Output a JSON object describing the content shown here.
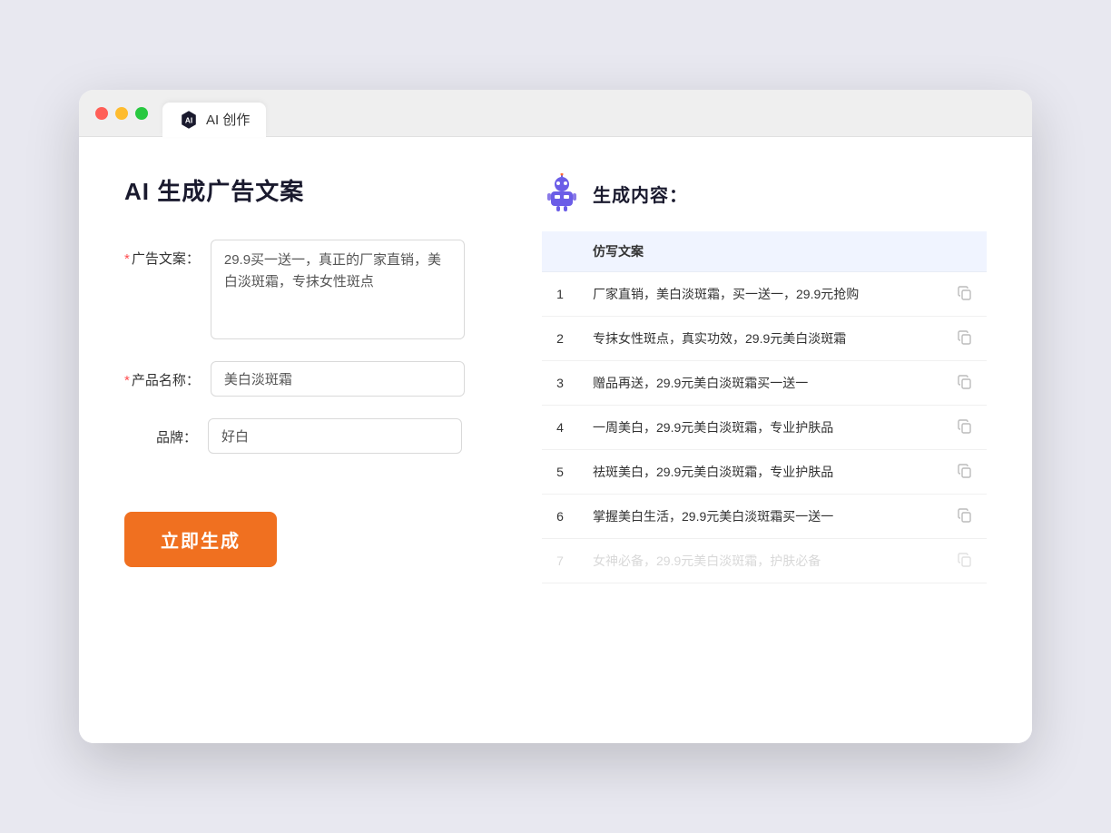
{
  "browser": {
    "tab_label": "AI 创作"
  },
  "page": {
    "title": "AI 生成广告文案"
  },
  "form": {
    "ad_label": "广告文案：",
    "ad_required": "*",
    "ad_value": "29.9买一送一，真正的厂家直销，美白淡斑霜，专抹女性斑点",
    "product_label": "产品名称：",
    "product_required": "*",
    "product_value": "美白淡斑霜",
    "brand_label": "品牌：",
    "brand_value": "好白",
    "generate_label": "立即生成"
  },
  "result": {
    "title": "生成内容：",
    "table_header": "仿写文案",
    "items": [
      {
        "num": "1",
        "text": "厂家直销，美白淡斑霜，买一送一，29.9元抢购",
        "faded": false
      },
      {
        "num": "2",
        "text": "专抹女性斑点，真实功效，29.9元美白淡斑霜",
        "faded": false
      },
      {
        "num": "3",
        "text": "赠品再送，29.9元美白淡斑霜买一送一",
        "faded": false
      },
      {
        "num": "4",
        "text": "一周美白，29.9元美白淡斑霜，专业护肤品",
        "faded": false
      },
      {
        "num": "5",
        "text": "祛斑美白，29.9元美白淡斑霜，专业护肤品",
        "faded": false
      },
      {
        "num": "6",
        "text": "掌握美白生活，29.9元美白淡斑霜买一送一",
        "faded": false
      },
      {
        "num": "7",
        "text": "女神必备，29.9元美白淡斑霜，护肤必备",
        "faded": true
      }
    ]
  }
}
